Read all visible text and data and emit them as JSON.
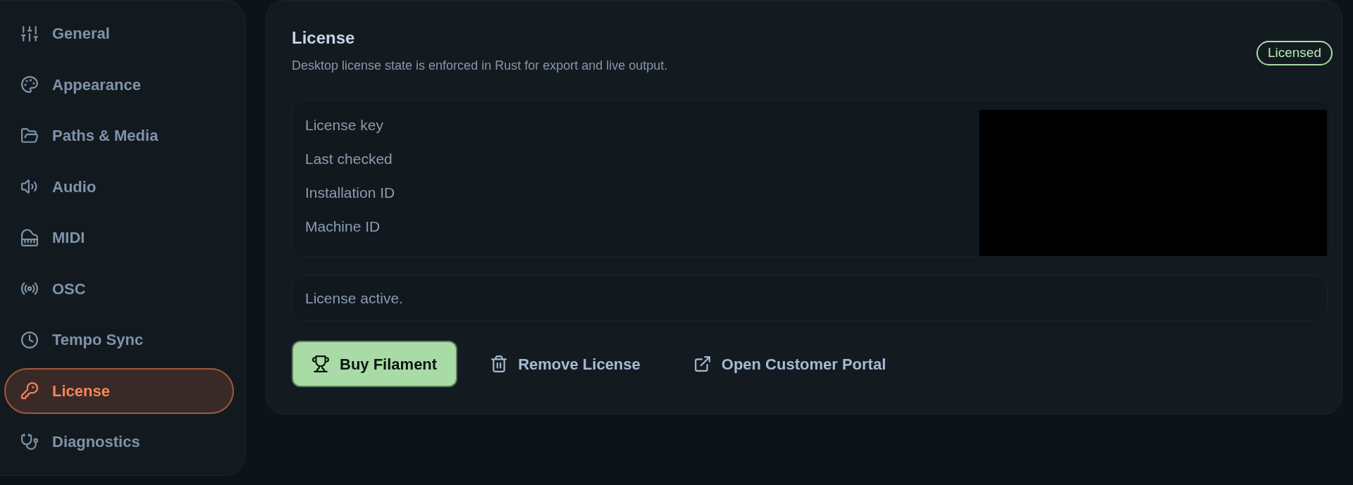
{
  "sidebar": {
    "items": [
      {
        "label": "General",
        "selected": false
      },
      {
        "label": "Appearance",
        "selected": false
      },
      {
        "label": "Paths & Media",
        "selected": false
      },
      {
        "label": "Audio",
        "selected": false
      },
      {
        "label": "MIDI",
        "selected": false
      },
      {
        "label": "OSC",
        "selected": false
      },
      {
        "label": "Tempo Sync",
        "selected": false
      },
      {
        "label": "License",
        "selected": true
      },
      {
        "label": "Diagnostics",
        "selected": false
      }
    ]
  },
  "section": {
    "title": "License",
    "description": "Desktop license state is enforced in Rust for export and live output.",
    "badge": "Licensed"
  },
  "details": {
    "rows": [
      {
        "label": "License key"
      },
      {
        "label": "Last checked"
      },
      {
        "label": "Installation ID"
      },
      {
        "label": "Machine ID"
      }
    ]
  },
  "status_message": "License active.",
  "actions": [
    {
      "label": "Buy Filament",
      "kind": "primary"
    },
    {
      "label": "Remove License",
      "kind": "plain"
    },
    {
      "label": "Open Customer Portal",
      "kind": "plain"
    }
  ]
}
